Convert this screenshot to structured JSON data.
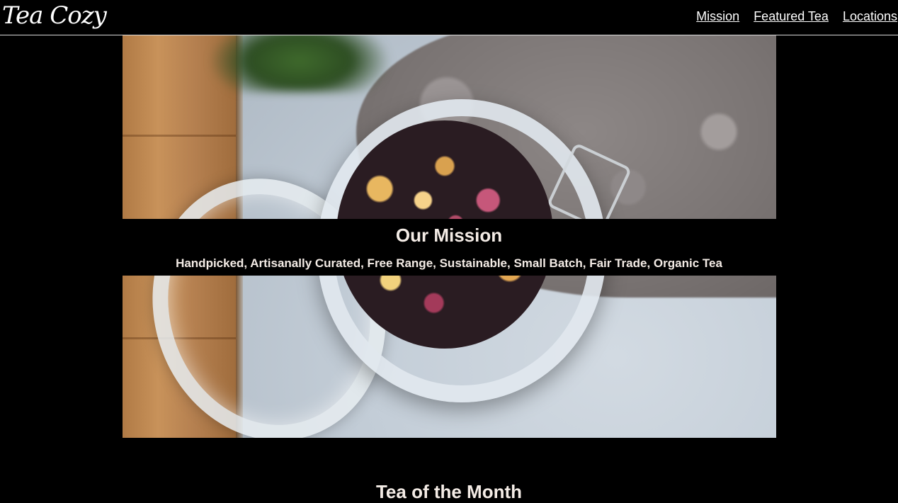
{
  "header": {
    "logo": "Tea Cozy",
    "nav": [
      {
        "label": "Mission"
      },
      {
        "label": "Featured Tea"
      },
      {
        "label": "Locations"
      }
    ]
  },
  "hero": {
    "image_subject": "jar of loose leaf tea on wooden board and table",
    "mission_title": "Our Mission",
    "mission_text": "Handpicked, Artisanally Curated, Free Range, Sustainable, Small Batch, Fair Trade, Organic Tea"
  },
  "tea_of_month": {
    "title": "Tea of the Month"
  },
  "colors": {
    "background": "#000000",
    "text": "#ffffff",
    "heading_text": "#f4ece6"
  }
}
